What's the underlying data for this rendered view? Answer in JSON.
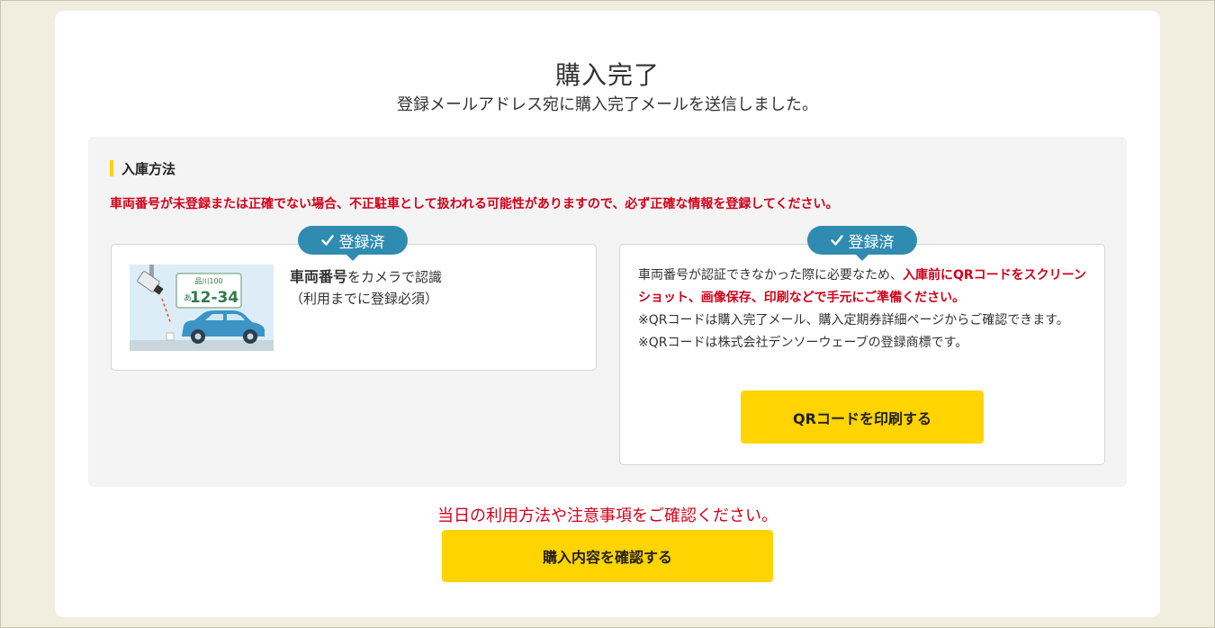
{
  "page": {
    "title": "購入完了",
    "subtitle": "登録メールアドレス宛に購入完了メールを送信しました。"
  },
  "method": {
    "section_title": "入庫方法",
    "warning": "車両番号が未登録または正確でない場合、不正駐車として扱われる可能性がありますので、必ず正確な情報を登録してください。"
  },
  "left_panel": {
    "badge_label": "登録済",
    "illustration": {
      "plate_area": "品川100",
      "plate_hiragana": "あ",
      "plate_number": "12-34"
    },
    "text_bold": "車両番号",
    "text_rest": "をカメラで認識",
    "text_note": "（利用までに登録必須）"
  },
  "right_panel": {
    "badge_label": "登録済",
    "line1_plain": "車両番号が認証できなかった際に必要なため、",
    "line1_red": "入庫前にQRコードをスクリーンショット、画像保存、印刷などで手元にご準備ください。",
    "note1": "※QRコードは購入完了メール、購入定期券詳細ページからご確認できます。",
    "note2": "※QRコードは株式会社デンソーウェーブの登録商標です。",
    "print_button": "QRコードを印刷する"
  },
  "footer": {
    "note": "当日の利用方法や注意事項をご確認ください。",
    "confirm_button": "購入内容を確認する"
  },
  "colors": {
    "accent_yellow": "#ffd400",
    "badge_blue": "#2f8cb0",
    "warning_red": "#d0021b",
    "page_bg": "#f1eee0"
  },
  "icons": [
    "check-icon",
    "camera-icon",
    "car-icon"
  ]
}
